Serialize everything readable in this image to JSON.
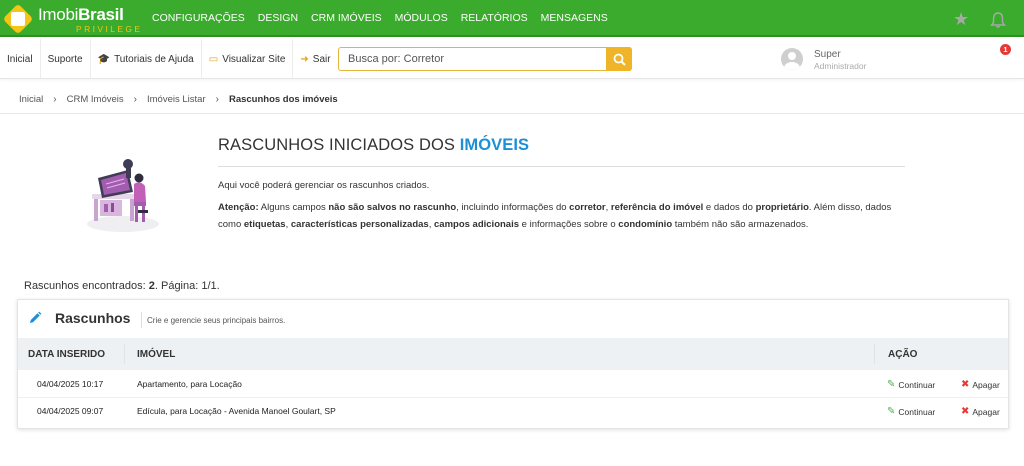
{
  "brand": {
    "name_light": "Imobi",
    "name_bold": "Brasil",
    "tagline": "PRIVILEGE"
  },
  "mainnav": [
    "CONFIGURAÇÕES",
    "DESIGN",
    "CRM IMÓVEIS",
    "MÓDULOS",
    "RELATÓRIOS",
    "MENSAGENS"
  ],
  "subnav": {
    "inicio": "Inicial",
    "suporte": "Suporte",
    "tutoriais": "Tutoriais de Ajuda",
    "visualizar": "Visualizar Site",
    "sair": "Sair"
  },
  "search": {
    "placeholder": "Busca por: Corretor",
    "value": ""
  },
  "user": {
    "name": "Super",
    "role": "Administrador"
  },
  "notifications": {
    "count": "1"
  },
  "breadcrumb": [
    "Inicial",
    "CRM Imóveis",
    "Imóveis Listar",
    "Rascunhos dos imóveis"
  ],
  "intro": {
    "title_plain": "RASCUNHOS INICIADOS DOS ",
    "title_accent": "IMÓVEIS",
    "p1": "Aqui você poderá gerenciar os rascunhos criados.",
    "p2_parts": {
      "a_bold": "Atenção:",
      "b": " Alguns campos ",
      "c_bold": "não são salvos no rascunho",
      "d": ", incluindo informações do ",
      "e_bold": "corretor",
      "f": ", ",
      "g_bold": "referência do imóvel",
      "h": " e dados do ",
      "i_bold": "proprietário",
      "j": ". Além disso, dados como ",
      "k_bold": "etiquetas",
      "l": ", ",
      "m_bold": "características personalizadas",
      "n": ", ",
      "o_bold": "campos adicionais",
      "p": " e informações sobre o ",
      "q_bold": "condomínio",
      "r": " também não são armazenados."
    }
  },
  "found": {
    "label": "Rascunhos encontrados: ",
    "count": "2",
    "page_label": ". Página: ",
    "page": "1/1."
  },
  "card": {
    "title": "Rascunhos",
    "subtitle": "Crie e gerencie seus principais bairros.",
    "columns": {
      "date": "DATA INSERIDO",
      "property": "IMÓVEL",
      "action": "AÇÃO"
    },
    "rows": [
      {
        "date": "04/04/2025 10:17",
        "property": "Apartamento, para Locação",
        "continue": "Continuar",
        "delete": "Apagar"
      },
      {
        "date": "04/04/2025 09:07",
        "property": "Edícula, para Locação - Avenida Manoel Goulart, SP",
        "continue": "Continuar",
        "delete": "Apagar"
      }
    ]
  },
  "colors": {
    "topbar": "#3aab2c",
    "accent_yellow": "#f0b429",
    "title_blue": "#1c8fd6",
    "delete_red": "#e53935",
    "edit_green": "#4caf50"
  }
}
